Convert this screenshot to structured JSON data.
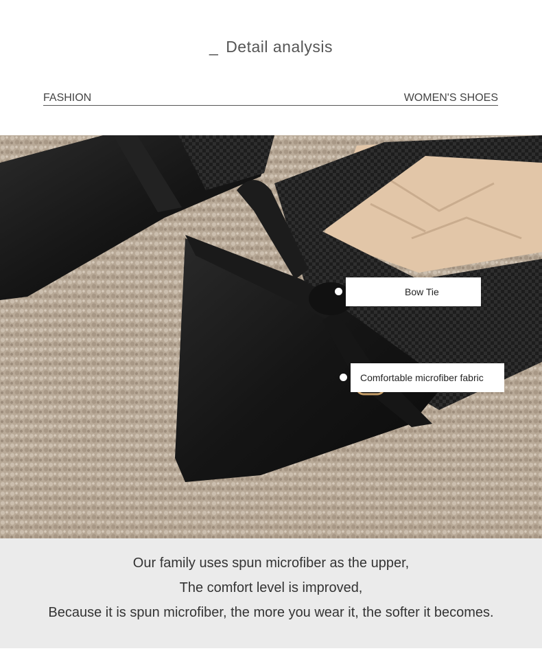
{
  "header": {
    "title_dash": "_",
    "title": "Detail analysis",
    "tag_left": "FASHION",
    "tag_right": "WOMEN'S SHOES"
  },
  "photo": {
    "callouts": [
      {
        "label": "Bow Tie"
      },
      {
        "label": "Comfortable microfiber fabric"
      }
    ]
  },
  "caption": {
    "lines": [
      "Our family uses spun microfiber as the upper,",
      "The comfort level is improved,",
      "Because it is spun microfiber, the more you wear it, the softer it becomes."
    ]
  }
}
